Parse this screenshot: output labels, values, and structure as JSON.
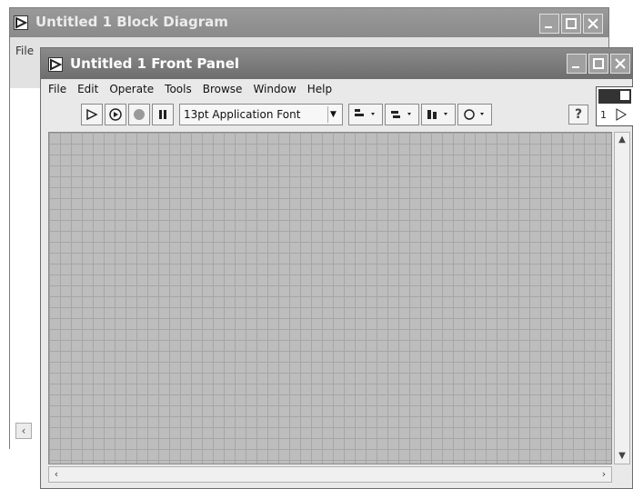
{
  "back_window": {
    "title": "Untitled 1 Block Diagram",
    "menu_stub": "File"
  },
  "front_window": {
    "title": "Untitled 1 Front Panel",
    "menu": [
      "File",
      "Edit",
      "Operate",
      "Tools",
      "Browse",
      "Window",
      "Help"
    ],
    "toolbar": {
      "font_select_value": "13pt Application Font",
      "icons": [
        "run-arrow-icon",
        "run-continuously-icon",
        "abort-icon",
        "pause-icon",
        "align-objects-icon",
        "distribute-objects-icon",
        "resize-objects-icon",
        "reorder-icon"
      ]
    },
    "help_label": "?",
    "connector_label": "1"
  },
  "colors": {
    "titlebar_front": "#6e6e6e",
    "titlebar_back": "#8a8a8a",
    "canvas_grid": "#bdbdbd"
  }
}
